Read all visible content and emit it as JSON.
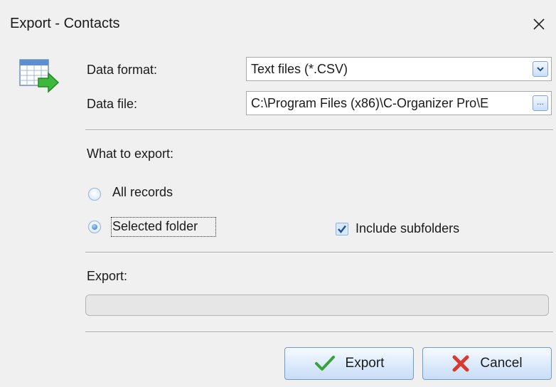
{
  "window": {
    "title": "Export - Contacts"
  },
  "form": {
    "data_format_label": "Data format:",
    "data_format_value": "Text files (*.CSV)",
    "data_file_label": "Data file:",
    "data_file_value": "C:\\Program Files (x86)\\C-Organizer Pro\\E",
    "browse_label": "..."
  },
  "what_to_export": {
    "heading": "What to export:",
    "options": [
      {
        "label": "All records",
        "selected": false
      },
      {
        "label": "Selected folder",
        "selected": true
      }
    ],
    "include_subfolders": {
      "label": "Include subfolders",
      "checked": true
    }
  },
  "export_progress": {
    "label": "Export:",
    "progress": 0
  },
  "buttons": {
    "export_label": "Export",
    "cancel_label": "Cancel"
  },
  "icons": {
    "app": "table-export-icon",
    "close": "close-icon",
    "export": "checkmark-icon",
    "cancel": "x-icon"
  },
  "colors": {
    "accent": "#2b73d0",
    "check_green": "#3aa23a",
    "cancel_red": "#d93a2b"
  }
}
